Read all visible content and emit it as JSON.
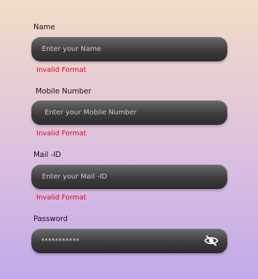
{
  "form": {
    "name": {
      "label": "Name",
      "placeholder": "Enter your Name",
      "error": "Invalid Format"
    },
    "mobile": {
      "label": "Mobile Number",
      "placeholder": "Enter your Mobile Number",
      "error": "Invalid Format"
    },
    "mail": {
      "label": "Mail -ID",
      "placeholder": "Enter your Mail -ID",
      "error": "Invalid Format"
    },
    "password": {
      "label": "Password",
      "value": "***********",
      "toggle_icon": "eye-slash-icon"
    }
  },
  "colors": {
    "error": "#e3001b",
    "field_top": "#6a6a6a",
    "field_bottom": "#2c2c2c",
    "bg_top": "#f2dcc6",
    "bg_bottom": "#c2a9ea"
  }
}
